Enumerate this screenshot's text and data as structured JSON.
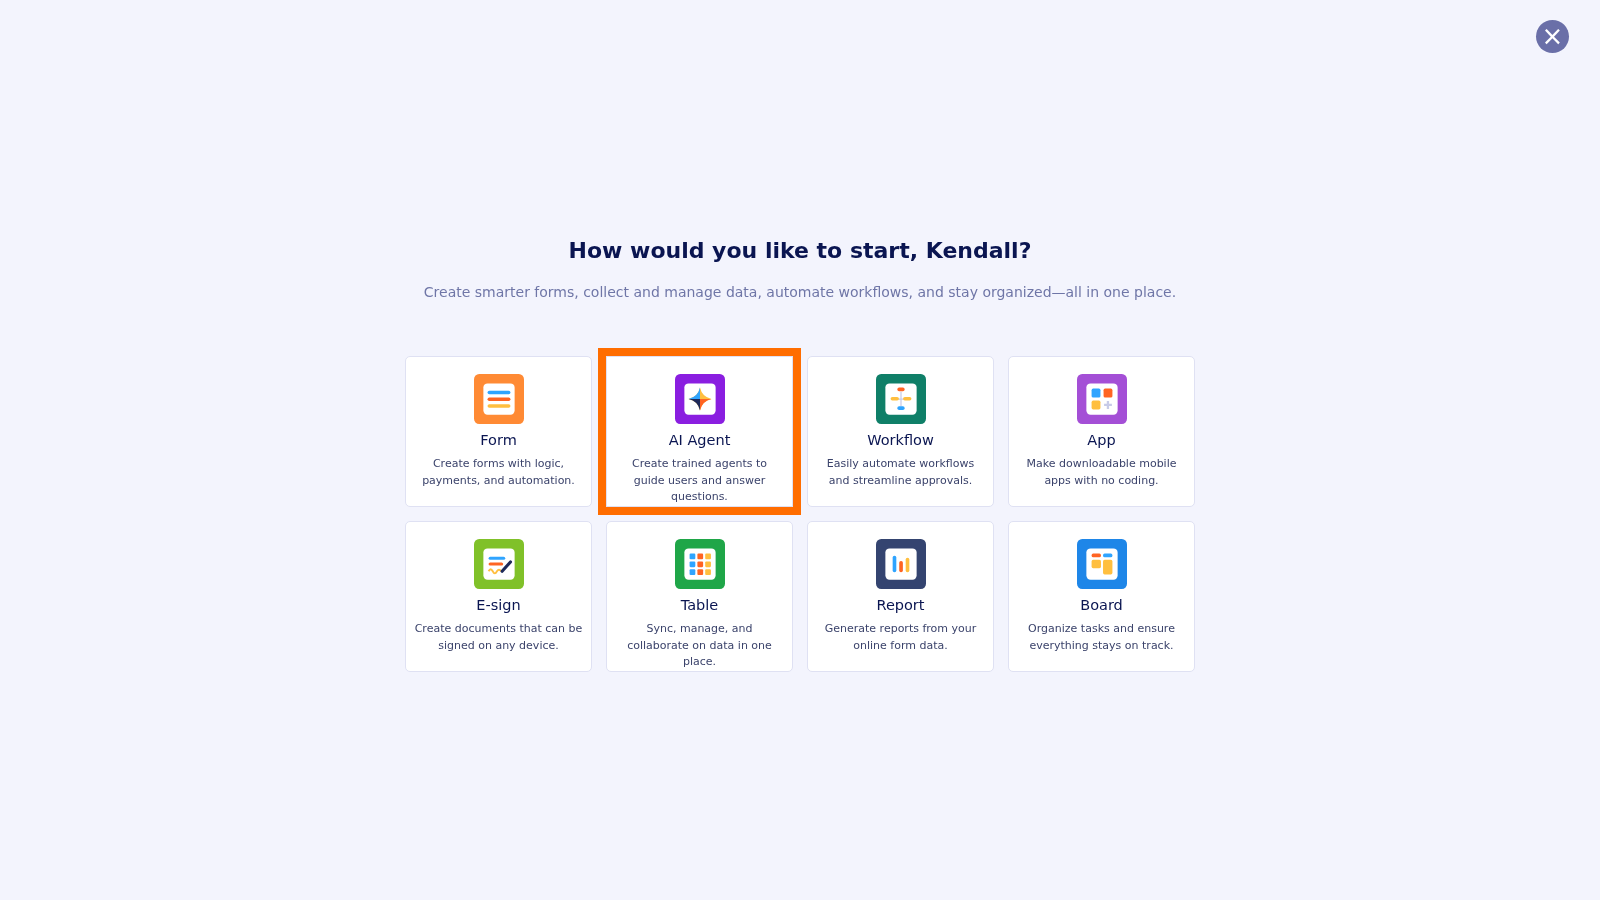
{
  "close_button": {
    "label": "×"
  },
  "heading": "How would you like to start, Kendall?",
  "subtitle": "Create smarter forms, collect and manage data, automate workflows, and stay organized—all in one place.",
  "options": [
    {
      "kind": "form",
      "color": "#ff8a34",
      "title": "Form",
      "description": "Create forms with logic, payments, and automation.",
      "selected": false
    },
    {
      "kind": "agent",
      "color": "#8a1ee0",
      "title": "AI Agent",
      "description": "Create trained agents to guide users and answer questions.",
      "selected": true
    },
    {
      "kind": "workflow",
      "color": "#0f7f68",
      "title": "Workflow",
      "description": "Easily automate workflows and streamline approvals.",
      "selected": false
    },
    {
      "kind": "app",
      "color": "#a44fd6",
      "title": "App",
      "description": "Make downloadable mobile apps with no coding.",
      "selected": false
    },
    {
      "kind": "esign",
      "color": "#80c129",
      "title": "E-sign",
      "description": "Create documents that can be signed on any device.",
      "selected": false
    },
    {
      "kind": "table",
      "color": "#1fa648",
      "title": "Table",
      "description": "Sync, manage, and collaborate on data in one place.",
      "selected": false
    },
    {
      "kind": "report",
      "color": "#344470",
      "title": "Report",
      "description": "Generate reports from your online form data.",
      "selected": false
    },
    {
      "kind": "board",
      "color": "#1e86e8",
      "title": "Board",
      "description": "Organize tasks and ensure everything stays on track.",
      "selected": false
    }
  ]
}
